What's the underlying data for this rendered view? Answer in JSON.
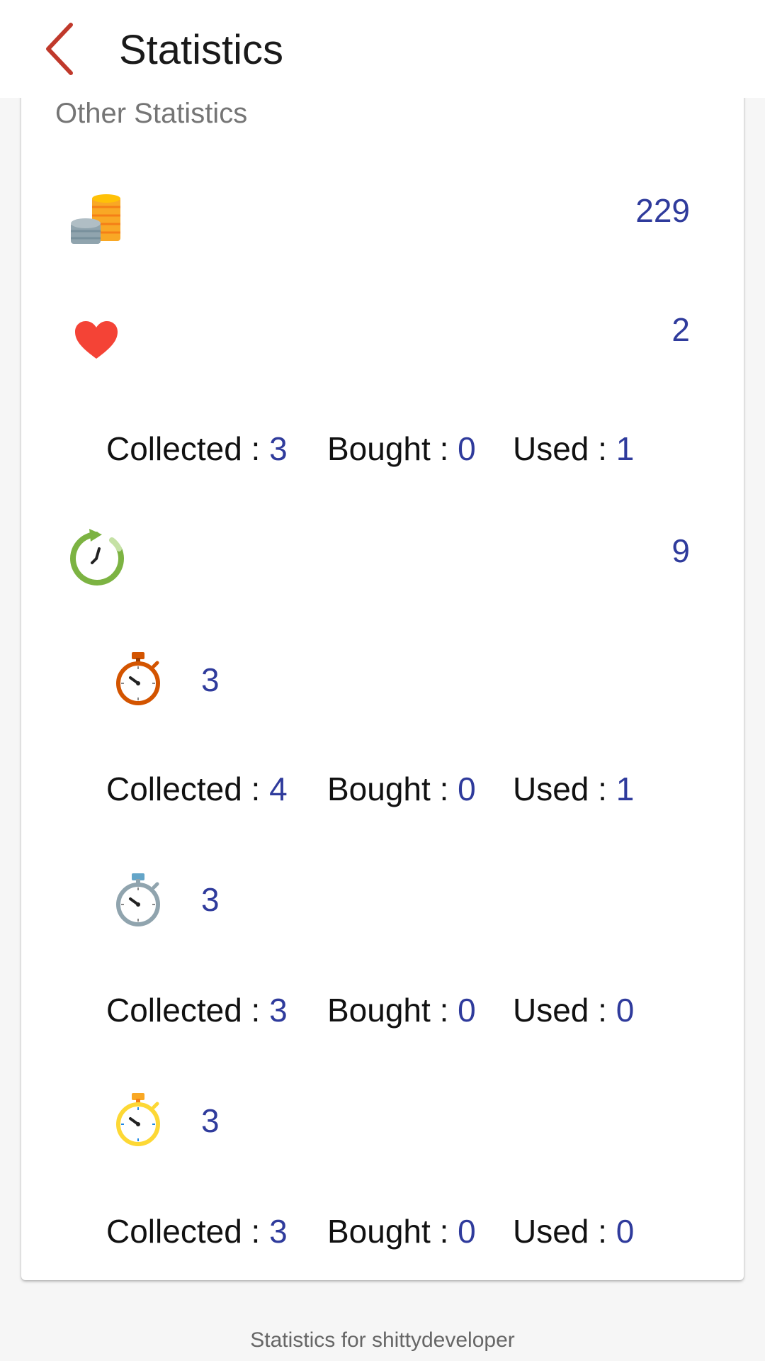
{
  "header": {
    "title": "Statistics",
    "back_icon": "chevron-left-icon"
  },
  "section": {
    "title": "Other Statistics"
  },
  "colors": {
    "accent": "#2f3b9c",
    "back": "#c0392b",
    "heart": "#f44336",
    "restart": "#7cb342"
  },
  "labels": {
    "collected": "Collected : ",
    "bought": "Bought : ",
    "used": "Used : "
  },
  "coins": {
    "icon": "coins-icon",
    "value": "229"
  },
  "lives": {
    "icon": "heart-icon",
    "value": "2",
    "collected": "3",
    "bought": "0",
    "used": "1"
  },
  "time_boosts": {
    "icon": "clock-restart-icon",
    "value": "9"
  },
  "stopwatches": [
    {
      "icon": "stopwatch-bronze-icon",
      "value": "3",
      "collected": "4",
      "bought": "0",
      "used": "1"
    },
    {
      "icon": "stopwatch-silver-icon",
      "value": "3",
      "collected": "3",
      "bought": "0",
      "used": "0"
    },
    {
      "icon": "stopwatch-gold-icon",
      "value": "3",
      "collected": "3",
      "bought": "0",
      "used": "0"
    }
  ],
  "footer": {
    "text": "Statistics for shittydeveloper"
  }
}
